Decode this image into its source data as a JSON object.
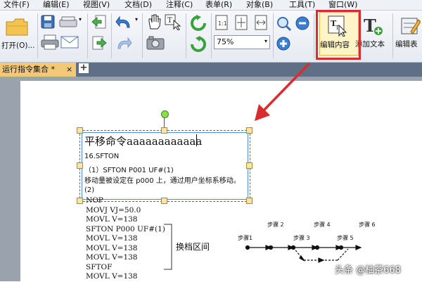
{
  "menu": [
    "文件(F)",
    "编辑(E)",
    "视图(V)",
    "文档(D)",
    "注释(C)",
    "表单(R)",
    "对象(B)",
    "工具(T)",
    "窗口(W)"
  ],
  "toolbar": {
    "open_label": "打开(O)...",
    "zoom_value": "75%",
    "edit_content_label": "编辑内容",
    "add_text_label": "添加文本",
    "edit_form_label": "编辑表"
  },
  "tabs": {
    "doc_tab": "运行指令集合 *",
    "add_tab": "+"
  },
  "textbox": {
    "title": "平移命令aaaaaaaaaaaa",
    "line1": "16.SFTON",
    "line2": "（1）SFTON P001 UF#(1)",
    "line3": "移动量被设定在 p000 上，通过用户坐标系移动。",
    "line4": "(2)"
  },
  "code_lines": [
    "NOP",
    "MOVJ VJ=50.0",
    "MOVL V=138",
    "SFTON P000 UF#(1)",
    "MOVL V=138",
    "MOVL V=138",
    "MOVL V=138",
    "SFTOF",
    "MOVL V=138"
  ],
  "bracket_label": "换档区间",
  "diagram": {
    "steps": [
      "步骤1",
      "步骤 2",
      "步骤 3",
      "步骤 4",
      "步骤 5",
      "步骤 6"
    ]
  },
  "watermark": "头条 @柚茶668",
  "colors": {
    "highlight_box": "#d92d2d",
    "selection_border": "#4a90d9",
    "tab_active": "#f2c879"
  }
}
